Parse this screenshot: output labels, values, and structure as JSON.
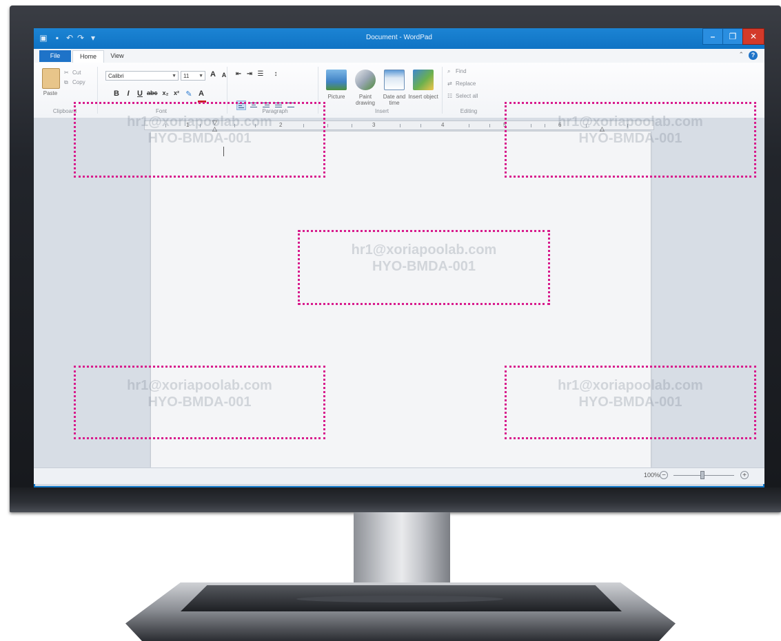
{
  "window": {
    "title": "Document - WordPad",
    "minimize": "–",
    "maximize": "❐",
    "close": "✕"
  },
  "tabs": [
    {
      "label": "File"
    },
    {
      "label": "Home"
    },
    {
      "label": "View"
    }
  ],
  "ribbon": {
    "clipboard": {
      "paste": "Paste",
      "cut": "Cut",
      "copy": "Copy",
      "label": "Clipboard"
    },
    "font": {
      "family": "Calibri",
      "size": "11",
      "label": "Font"
    },
    "paragraph": {
      "label": "Paragraph"
    },
    "insert": {
      "picture": "Picture",
      "paint": "Paint drawing",
      "datetime": "Date and time",
      "object": "Insert object",
      "label": "Insert"
    },
    "editing": {
      "find": "Find",
      "replace": "Replace",
      "select_all": "Select all",
      "label": "Editing"
    }
  },
  "ruler": {
    "numbers": [
      "1",
      "2",
      "3",
      "4",
      "5",
      "6"
    ]
  },
  "status": {
    "zoom": "100%"
  },
  "watermark": {
    "line1": "hr1@xoriapoolab.com",
    "line2": "HYO-BMDA-001"
  }
}
